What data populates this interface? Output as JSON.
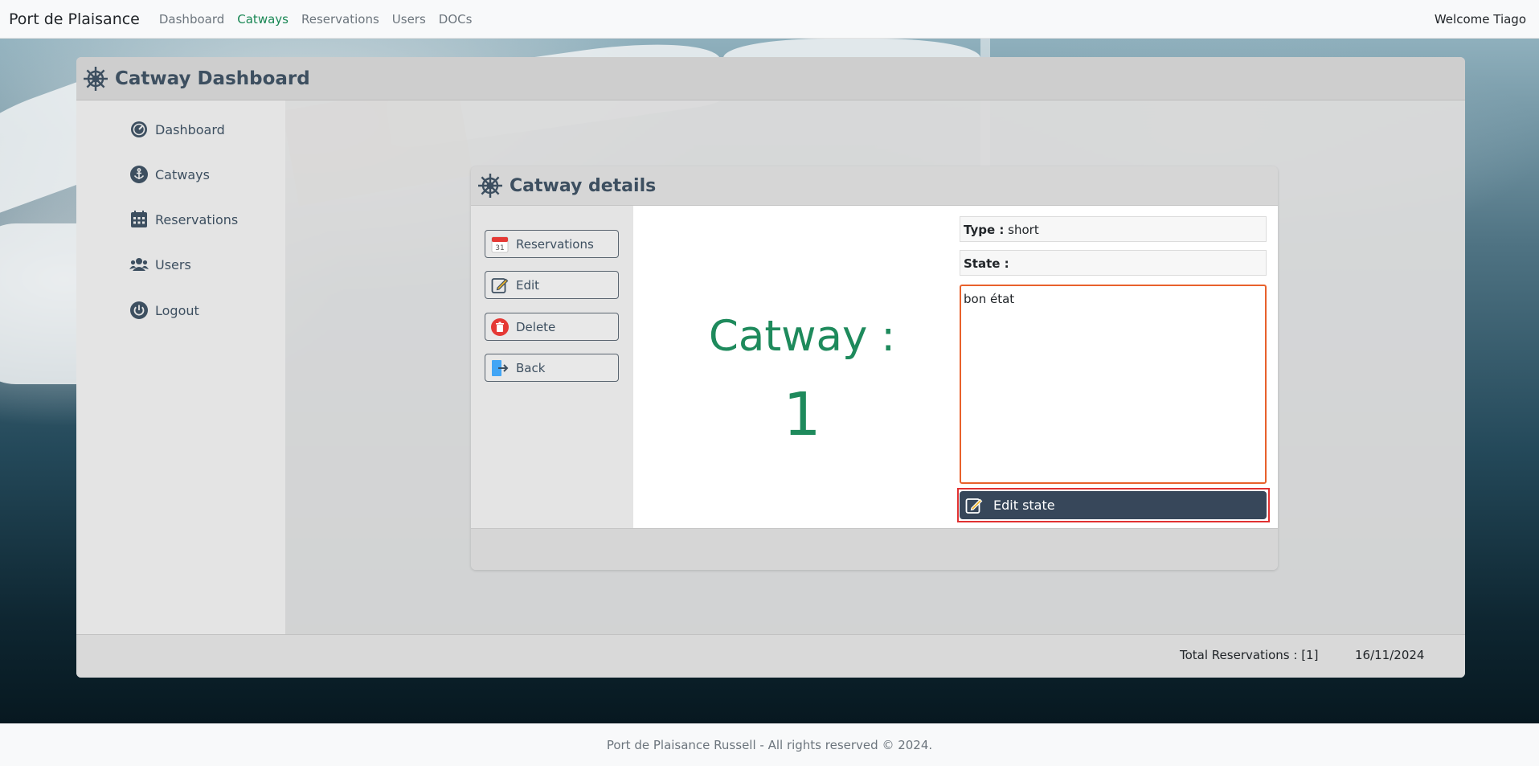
{
  "navbar": {
    "brand": "Port de Plaisance",
    "links": [
      "Dashboard",
      "Catways",
      "Reservations",
      "Users",
      "DOCs"
    ],
    "active": "Catways",
    "welcome": "Welcome Tiago"
  },
  "dashboard": {
    "title": "Catway Dashboard",
    "sidebar": [
      {
        "label": "Dashboard",
        "icon": "dashboard-gauge-icon"
      },
      {
        "label": "Catways",
        "icon": "anchor-icon"
      },
      {
        "label": "Reservations",
        "icon": "calendar-grid-icon"
      },
      {
        "label": "Users",
        "icon": "users-icon"
      },
      {
        "label": "Logout",
        "icon": "power-icon"
      }
    ],
    "footer": {
      "total_reservations": "Total Reservations : [1]",
      "date": "16/11/2024"
    }
  },
  "details": {
    "title": "Catway details",
    "menu": [
      {
        "label": "Reservations",
        "icon": "calendar-icon"
      },
      {
        "label": "Edit",
        "icon": "edit-icon"
      },
      {
        "label": "Delete",
        "icon": "trash-icon"
      },
      {
        "label": "Back",
        "icon": "exit-icon"
      }
    ],
    "catway_label": "Catway :",
    "catway_number": "1",
    "type_label": "Type :",
    "type_value": "short",
    "state_label": "State :",
    "state_value": "bon état",
    "edit_state_label": "Edit state"
  },
  "page_footer": "Port de Plaisance Russell - All rights reserved © 2024.",
  "colors": {
    "accent_green": "#198754",
    "catway_green": "#1e8a5c",
    "dark_button": "#37475a",
    "focus_orange": "#e8612c",
    "highlight_red": "#e03131"
  }
}
